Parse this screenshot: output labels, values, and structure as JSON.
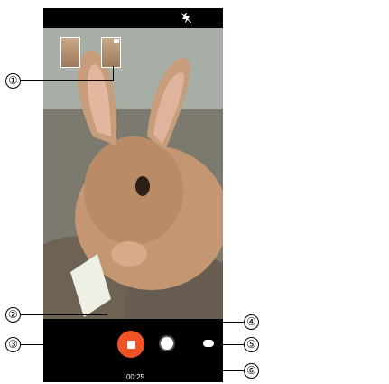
{
  "camera": {
    "status_icons": {
      "flash": "flash-off-icon"
    },
    "viewfinder_subject": "rabbit-photo",
    "thumbnails": [
      {
        "name": "thumbnail-preview-1"
      },
      {
        "name": "thumbnail-preview-2",
        "icon": "camera-icon"
      }
    ],
    "controls": {
      "record": {
        "icon": "stop-icon",
        "color": "#ef5326"
      },
      "shutter": {
        "icon": "shutter-icon"
      },
      "pause": {
        "icon": "pause-icon"
      }
    },
    "timer": "00:25"
  },
  "callouts": [
    {
      "label": "①"
    },
    {
      "label": "②"
    },
    {
      "label": "③"
    },
    {
      "label": "④"
    },
    {
      "label": "⑤"
    },
    {
      "label": "⑥"
    }
  ]
}
